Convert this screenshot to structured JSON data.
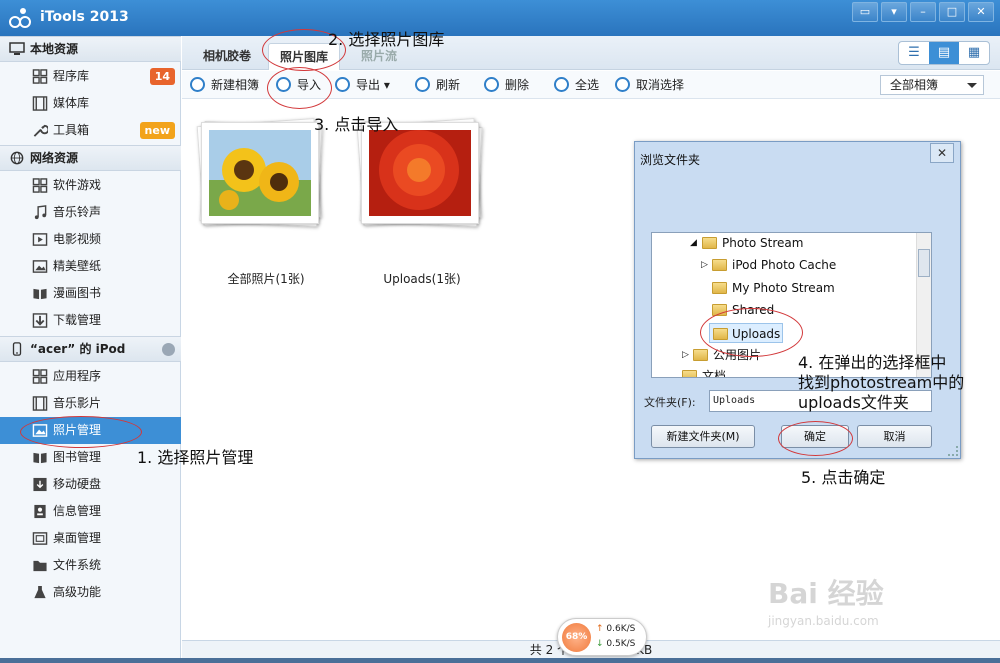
{
  "app": {
    "title": "iTools 2013",
    "accent_color": "#3d8fd6",
    "window_buttons": [
      "feedback-icon",
      "menu-icon",
      "minimize-icon",
      "maximize-icon",
      "close-icon"
    ]
  },
  "sidebar": {
    "sections": [
      {
        "title": "本地资源",
        "icon": "monitor-icon"
      },
      {
        "title": "网络资源",
        "icon": "globe-icon"
      },
      {
        "title": "“acer” 的 iPod",
        "icon": "ipod-icon"
      }
    ],
    "local": [
      {
        "label": "程序库",
        "icon": "apps-grid-icon",
        "badge": "14",
        "badge_color": "#e8642c"
      },
      {
        "label": "媒体库",
        "icon": "film-icon"
      },
      {
        "label": "工具箱",
        "icon": "wrench-icon",
        "badge": "new",
        "badge_color": "#f2a31b"
      }
    ],
    "network": [
      {
        "label": "软件游戏",
        "icon": "apps-grid-icon"
      },
      {
        "label": "音乐铃声",
        "icon": "music-note-icon"
      },
      {
        "label": "电影视频",
        "icon": "video-icon"
      },
      {
        "label": "精美壁纸",
        "icon": "wallpaper-icon"
      },
      {
        "label": "漫画图书",
        "icon": "book-icon"
      },
      {
        "label": "下载管理",
        "icon": "download-icon"
      }
    ],
    "device": [
      {
        "label": "应用程序",
        "icon": "apps-grid-icon"
      },
      {
        "label": "音乐影片",
        "icon": "film-icon"
      },
      {
        "label": "照片管理",
        "icon": "photo-icon",
        "active": true
      },
      {
        "label": "图书管理",
        "icon": "book-icon"
      },
      {
        "label": "移动硬盘",
        "icon": "disk-icon"
      },
      {
        "label": "信息管理",
        "icon": "contacts-icon"
      },
      {
        "label": "桌面管理",
        "icon": "desktop-icon"
      },
      {
        "label": "文件系统",
        "icon": "folder-icon"
      },
      {
        "label": "高级功能",
        "icon": "flask-icon"
      }
    ]
  },
  "tabs": [
    {
      "label": "相机胶卷"
    },
    {
      "label": "照片图库",
      "active": true
    },
    {
      "label": "照片流",
      "disabled": true
    }
  ],
  "toolbar": {
    "new_album": "新建相簿",
    "import": "导入",
    "export": "导出",
    "refresh": "刷新",
    "delete": "删除",
    "select_all": "全选",
    "deselect": "取消选择",
    "album_filter": "全部相簿"
  },
  "albums": [
    {
      "label": "全部照片(1张)",
      "thumb": "sunflower"
    },
    {
      "label": "Uploads(1张)",
      "thumb": "red-flower"
    }
  ],
  "status": {
    "text": "共 2 个相簿……63 KB",
    "cpu_percent": "68%",
    "upload_speed": "0.6K/S",
    "download_speed": "0.5K/S"
  },
  "dialog": {
    "title": "浏览文件夹",
    "close": "✕",
    "tree": [
      {
        "label": "Photo Stream",
        "expanded": true,
        "level": 0
      },
      {
        "label": "iPod Photo Cache",
        "expanded": false,
        "level": 1
      },
      {
        "label": "My Photo Stream",
        "level": 1
      },
      {
        "label": "Shared",
        "level": 1
      },
      {
        "label": "Uploads",
        "level": 1,
        "selected": true
      },
      {
        "label": "公用图片",
        "expanded": false,
        "level": -1
      },
      {
        "label": "文档",
        "level": -2
      }
    ],
    "folder_label": "文件夹(F):",
    "folder_value": "Uploads",
    "new_folder": "新建文件夹(M)",
    "ok": "确定",
    "cancel": "取消"
  },
  "annotations": {
    "step1": "1. 选择照片管理",
    "step2": "2. 选择照片图库",
    "step3": "3. 点击导入",
    "step4_line1": "4. 在弹出的选择框中",
    "step4_line2": "找到photostream中的",
    "step4_line3": "uploads文件夹",
    "step5": "5. 点击确定",
    "oval_color": "#d2383a"
  },
  "watermark": {
    "brand": "Bai 经验",
    "url": "jingyan.baidu.com"
  }
}
